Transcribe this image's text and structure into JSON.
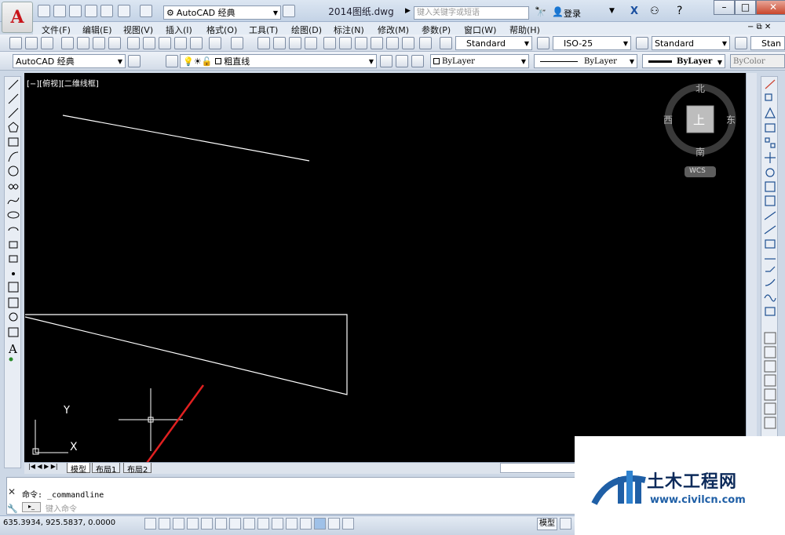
{
  "app": {
    "logo": "A",
    "title": "2014图纸.dwg"
  },
  "quick_access": {
    "workspace": "AutoCAD 经典"
  },
  "search": {
    "placeholder": "键入关键字或短语"
  },
  "user": {
    "login": "登录"
  },
  "menus": [
    "文件(F)",
    "编辑(E)",
    "视图(V)",
    "插入(I)",
    "格式(O)",
    "工具(T)",
    "绘图(D)",
    "标注(N)",
    "修改(M)",
    "参数(P)",
    "窗口(W)",
    "帮助(H)"
  ],
  "styles": {
    "text_style": "Standard",
    "dim_style": "ISO-25",
    "table_style": "Standard",
    "multileader_style": "Stan"
  },
  "layers": {
    "workspace": "AutoCAD 经典",
    "current_layer": "粗直线",
    "color": "ByLayer",
    "linetype": "ByLayer",
    "lineweight": "ByLayer",
    "plotstyle": "ByColor"
  },
  "viewport": {
    "label": "[−][俯视][二维线框]"
  },
  "viewcube": {
    "north": "北",
    "south": "南",
    "east": "东",
    "west": "西",
    "top": "上",
    "wcs": "WCS"
  },
  "ucs": {
    "x": "X",
    "y": "Y"
  },
  "tabs": [
    "模型",
    "布局1",
    "布局2"
  ],
  "command": {
    "history_prefix": "命令:",
    "history_text": "_commandline",
    "prompt": "键入命令"
  },
  "status": {
    "coords": "635.3934,  925.5837,  0.0000",
    "model": "模型"
  },
  "watermark": {
    "cn": "土木工程网",
    "url": "www.civilcn.com"
  },
  "colors": {
    "canvas": "#000000",
    "lines": "#ffffff",
    "arrow": "#e02020",
    "logo_red": "#c8141a",
    "watermark_blue": "#1f5fa6"
  }
}
